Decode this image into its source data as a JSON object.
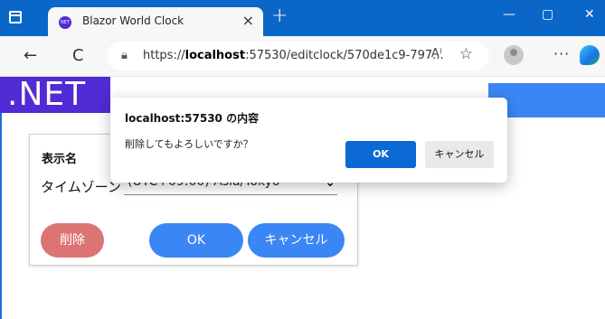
{
  "browser": {
    "tab_title": "Blazor World Clock",
    "tab_icon_text": "NET",
    "tab_close": "×",
    "new_tab": "+",
    "window_buttons": {
      "minimize": "—",
      "maximize": "▢",
      "close": "✕"
    },
    "nav": {
      "back": "←",
      "refresh": "C"
    },
    "url_prefix": "https://",
    "url_host": "localhost",
    "url_rest": ":57530/editclock/570de1c9-797...",
    "read_aloud": "A⁾",
    "favorite": "☆",
    "more": "···"
  },
  "page": {
    "logo_text": ".NET",
    "form": {
      "display_name_label": "表示名",
      "timezone_label": "タイムゾーン",
      "timezone_value": "(UTC+09:00) Asia/Tokyo",
      "delete_label": "削除",
      "ok_label": "OK",
      "cancel_label": "キャンセル"
    }
  },
  "dialog": {
    "title": "localhost:57530 の内容",
    "message": "削除してもよろしいですか？",
    "ok_label": "OK",
    "cancel_label": "キャンセル"
  },
  "colors": {
    "titlebar": "#0a66c7",
    "dotnet_purple": "#512bd4",
    "primary_button": "#3b86f5",
    "danger_button": "#dc7474",
    "dialog_ok": "#0b69d4"
  }
}
